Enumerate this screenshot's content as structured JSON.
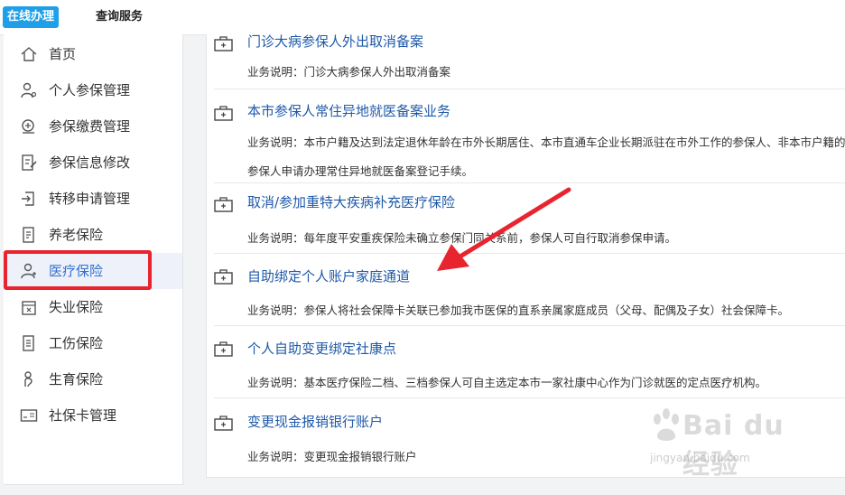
{
  "topbar": {
    "tab_online": "在线办理",
    "tab_query": "查询服务"
  },
  "sidebar": {
    "items": [
      {
        "label": "首页",
        "icon": "home-icon"
      },
      {
        "label": "个人参保管理",
        "icon": "person-gear-icon"
      },
      {
        "label": "参保缴费管理",
        "icon": "payment-icon"
      },
      {
        "label": "参保信息修改",
        "icon": "edit-document-icon"
      },
      {
        "label": "转移申请管理",
        "icon": "transfer-icon"
      },
      {
        "label": "养老保险",
        "icon": "pension-document-icon"
      },
      {
        "label": "医疗保险",
        "icon": "medical-person-icon"
      },
      {
        "label": "失业保险",
        "icon": "unemployment-icon"
      },
      {
        "label": "工伤保险",
        "icon": "injury-document-icon"
      },
      {
        "label": "生育保险",
        "icon": "maternity-icon"
      },
      {
        "label": "社保卡管理",
        "icon": "si-card-icon"
      }
    ],
    "active_index": 6
  },
  "services": [
    {
      "title": "门诊大病参保人外出取消备案",
      "desc": "业务说明：门诊大病参保人外出取消备案"
    },
    {
      "title": "本市参保人常住异地就医备案业务",
      "desc": "业务说明：本市户籍及达到法定退休年龄在市外长期居住、本市直通车企业长期派驻在市外工作的参保人、非本市户籍的参保人申请办理常住异地就医备案登记手续。"
    },
    {
      "title": "取消/参加重特大疾病补充医疗保险",
      "desc": "业务说明：每年度平安重疾保险未确立参保门同关系前，参保人可自行取消参保申请。"
    },
    {
      "title": "自助绑定个人账户家庭通道",
      "desc": "业务说明：参保人将社会保障卡关联已参加我市医保的直系亲属家庭成员（父母、配偶及子女）社会保障卡。"
    },
    {
      "title": "个人自助变更绑定社康点",
      "desc": "业务说明：基本医疗保险二档、三档参保人可自主选定本市一家社康中心作为门诊就医的定点医疗机构。"
    },
    {
      "title": "变更现金报销银行账户",
      "desc": "业务说明：变更现金报销银行账户"
    }
  ],
  "watermark": {
    "brand": "Bai du 经验",
    "url": "jingyan.baidu.com"
  },
  "colors": {
    "accent_blue": "#1e9fe8",
    "link_blue": "#1f5aa8",
    "highlight_red": "#e8252f",
    "active_bg": "#eef1fa"
  }
}
